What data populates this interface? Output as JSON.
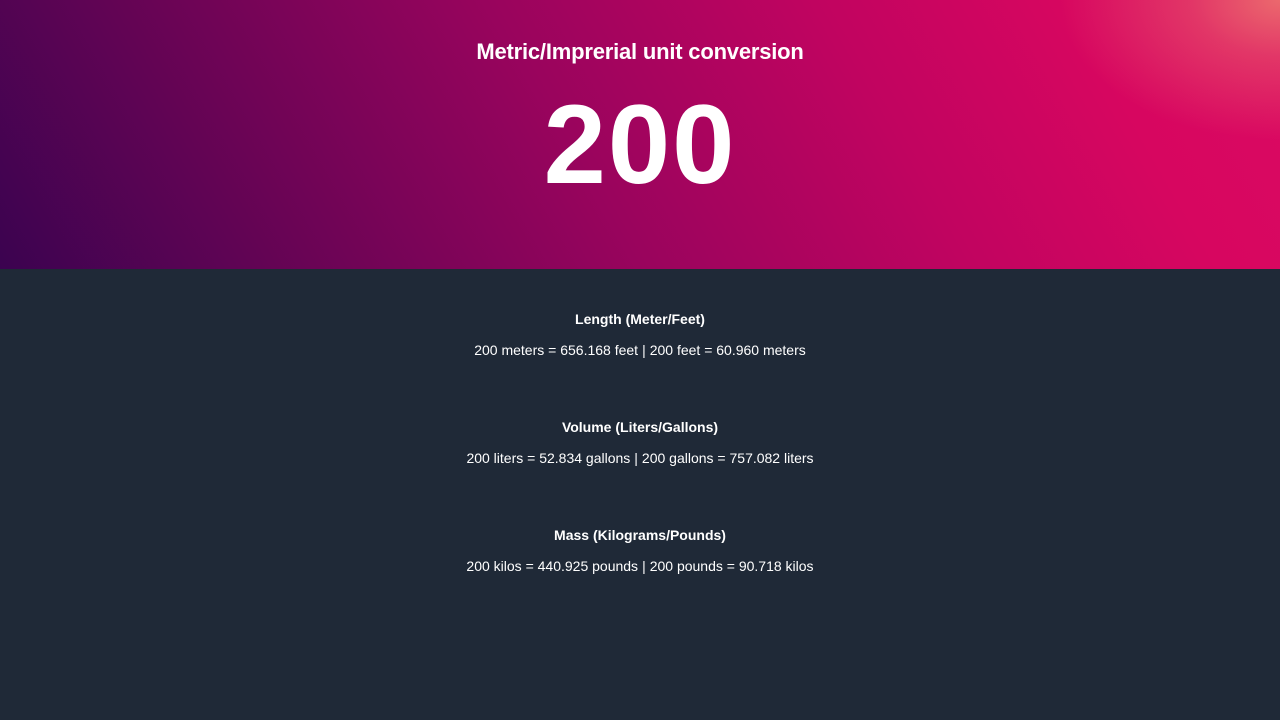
{
  "header": {
    "title": "Metric/Imprerial unit conversion",
    "value": "200"
  },
  "colors": {
    "background": "#1f2937",
    "gradient_start": "#3b0350",
    "gradient_end": "#db0a62",
    "text": "#ffffff"
  },
  "conversions": [
    {
      "title": "Length (Meter/Feet)",
      "left": "200 meters = 656.168 feet",
      "separator": "|",
      "right": "200 feet = 60.960 meters"
    },
    {
      "title": "Volume (Liters/Gallons)",
      "left": "200 liters = 52.834 gallons",
      "separator": "|",
      "right": "200 gallons = 757.082 liters"
    },
    {
      "title": "Mass (Kilograms/Pounds)",
      "left": "200 kilos = 440.925 pounds",
      "separator": "|",
      "right": "200 pounds = 90.718 kilos"
    }
  ]
}
